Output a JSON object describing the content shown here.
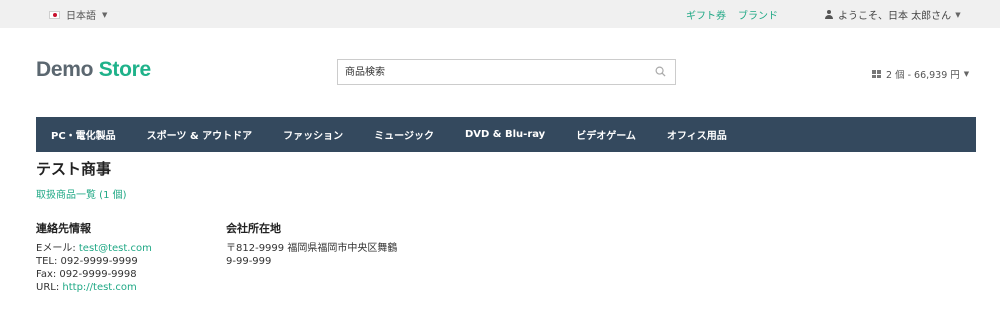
{
  "topbar": {
    "language": "日本語",
    "links": [
      "ギフト券",
      "ブランド"
    ],
    "user_greeting": "ようこそ、日本 太郎さん"
  },
  "logo": {
    "part1": "Demo",
    "part2": "Store"
  },
  "search": {
    "placeholder": "商品検索",
    "icon": "search-icon"
  },
  "cart": {
    "summary": "2 個 - 66,939 円",
    "icon": "cart-icon"
  },
  "nav": {
    "items": [
      "PC・電化製品",
      "スポーツ & アウトドア",
      "ファッション",
      "ミュージック",
      "DVD & Blu-ray",
      "ビデオゲーム",
      "オフィス用品"
    ]
  },
  "shop": {
    "title": "テスト商事",
    "product_link": "取扱商品一覧 (1 個)"
  },
  "contact": {
    "heading": "連絡先情報",
    "email_label": "Eメール: ",
    "email": "test@test.com",
    "tel": "TEL: 092-9999-9999",
    "fax": "Fax: 092-9999-9998",
    "url_label": "URL: ",
    "url": "http://test.com"
  },
  "address": {
    "heading": "会社所在地",
    "line1": "〒812-9999 福岡県福岡市中央区舞鶴",
    "line2": "9-99-999"
  },
  "colors": {
    "accent": "#1fa885",
    "nav_bg": "#34495e",
    "topbar_bg": "#f0f0f0"
  }
}
